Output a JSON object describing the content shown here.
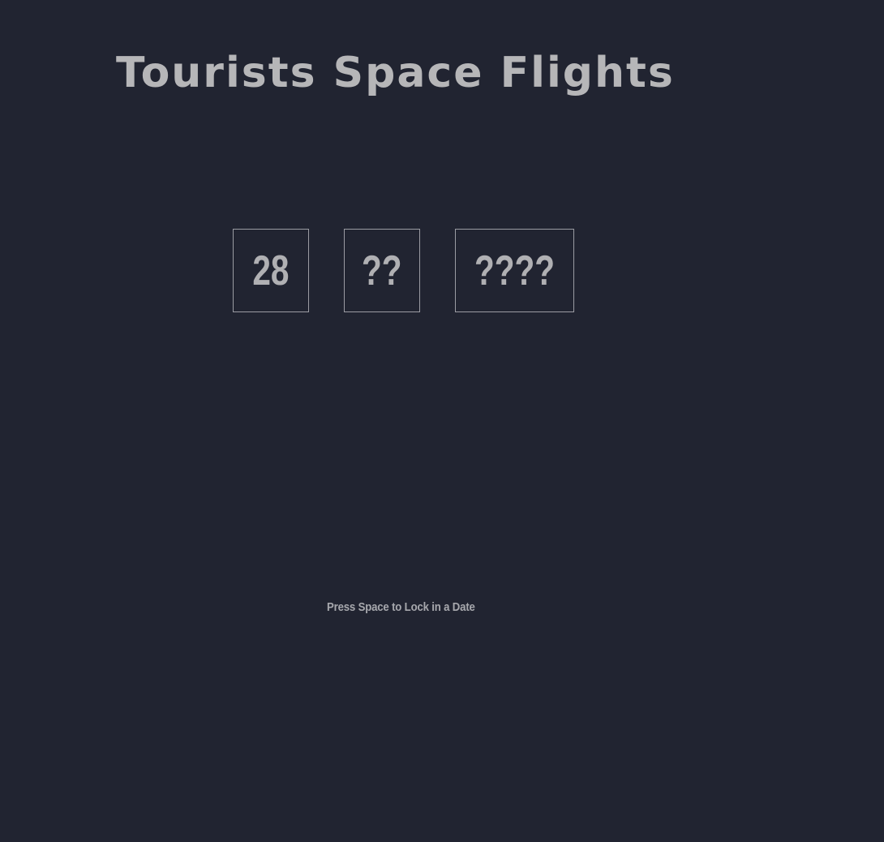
{
  "header": {
    "title": "Tourists Space Flights"
  },
  "date_picker": {
    "day": "28",
    "month": "??",
    "year": "????"
  },
  "instructions": {
    "hint": "Press Space to Lock in a Date"
  },
  "colors": {
    "background": "#212431",
    "text": "#b6b6b8",
    "box_border": "#9b9ca3"
  }
}
